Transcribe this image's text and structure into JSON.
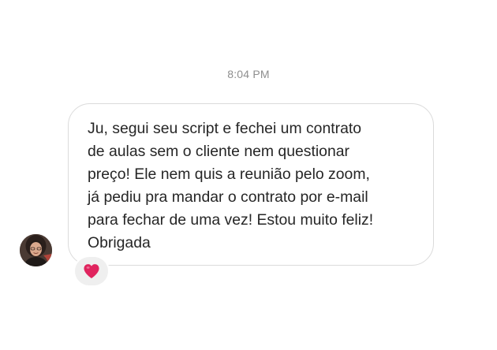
{
  "timestamp": "8:04 PM",
  "message": {
    "text": "Ju, segui seu script e fechei um contrato\nde aulas sem o cliente nem questionar\npreço! Ele nem quis a reunião pelo zoom,\njá pediu pra mandar o contrato por e-mail\npara fechar de uma vez! Estou muito feliz!\nObrigada",
    "reaction_icon": "heart-icon",
    "reaction_color": "#e0245e"
  },
  "colors": {
    "bubble_border": "#dbdbdb",
    "text": "#262626",
    "timestamp": "#8e8e8e",
    "reaction_bg": "#efefef"
  }
}
